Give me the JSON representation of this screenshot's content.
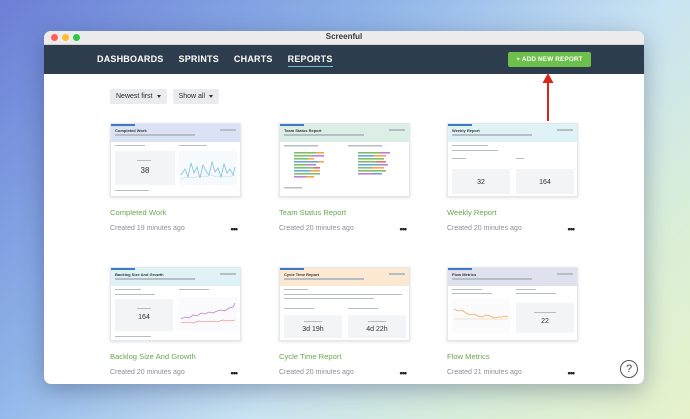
{
  "window": {
    "title": "Screenful"
  },
  "nav": {
    "items": [
      "DASHBOARDS",
      "SPRINTS",
      "CHARTS",
      "REPORTS"
    ],
    "active": "REPORTS",
    "add_button": "+ ADD NEW REPORT"
  },
  "filters": {
    "sort": "Newest first",
    "show": "Show all"
  },
  "reports": [
    {
      "title": "Completed Work",
      "meta": "Created 19 minutes ago",
      "thumb_title": "Completed Work",
      "metric_a": "38",
      "accent": "#d9e3f5"
    },
    {
      "title": "Team Status Report",
      "meta": "Created 20 minutes ago",
      "thumb_title": "Team Status Report",
      "accent": "#dcefe6"
    },
    {
      "title": "Weekly Report",
      "meta": "Created 20 minutes ago",
      "thumb_title": "Weekly Report",
      "metric_a": "32",
      "metric_b": "164",
      "accent": "#dff3f7"
    },
    {
      "title": "Backlog Size And Growth",
      "meta": "Created 20 minutes ago",
      "thumb_title": "Backlog Size And Growth",
      "metric_a": "164",
      "accent": "#dff3f7"
    },
    {
      "title": "Cycle Time Report",
      "meta": "Created 20 minutes ago",
      "thumb_title": "Cycle Time Report",
      "metric_a": "3d 19h",
      "metric_b": "4d 22h",
      "accent": "#fde9d2"
    },
    {
      "title": "Flow Metrics",
      "meta": "Created 21 minutes ago",
      "thumb_title": "Flow Metrics",
      "metric_a": "22",
      "accent": "#dfe2ee"
    }
  ],
  "help": {
    "label": "?"
  }
}
